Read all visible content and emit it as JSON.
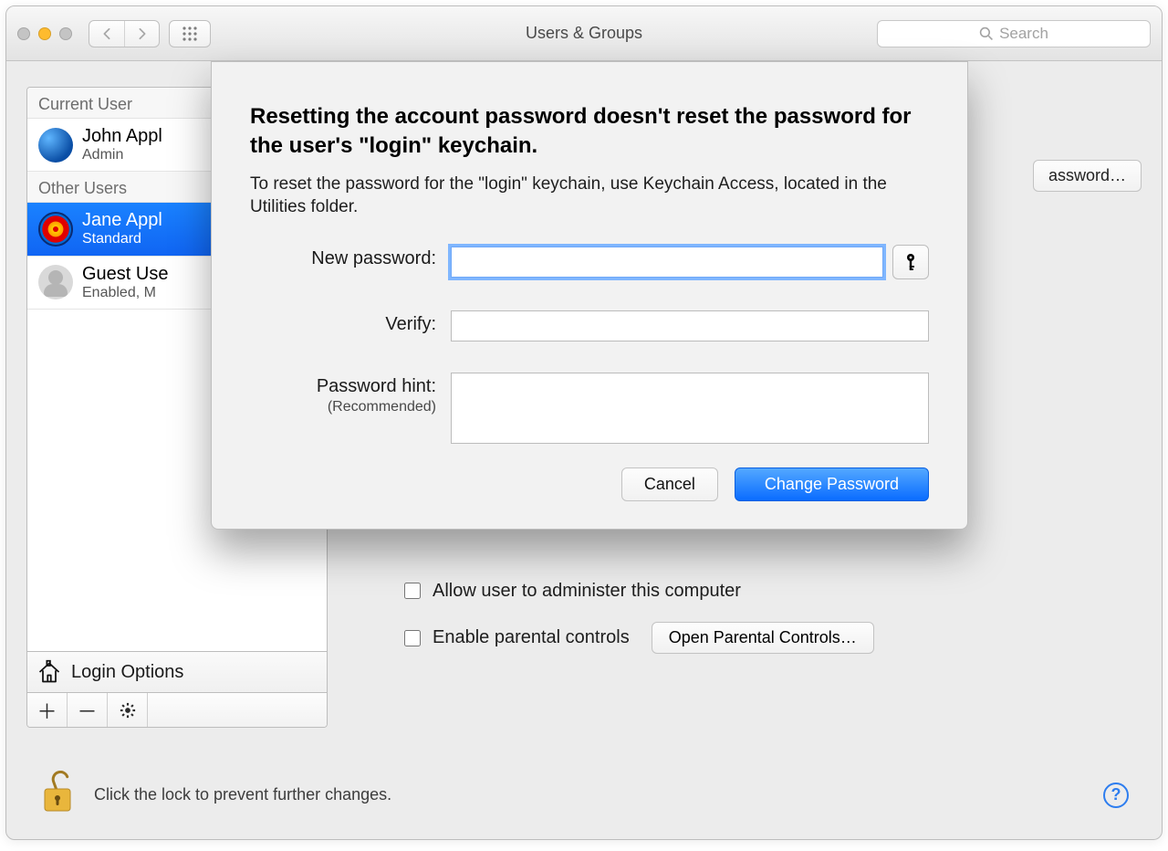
{
  "window": {
    "title": "Users & Groups",
    "search_placeholder": "Search"
  },
  "sidebar": {
    "current_label": "Current User",
    "other_label": "Other Users",
    "current_user": {
      "name": "John Appl",
      "role": "Admin"
    },
    "other_users": [
      {
        "name": "Jane Appl",
        "role": "Standard",
        "selected": true
      },
      {
        "name": "Guest Use",
        "role": "Enabled, M",
        "selected": false
      }
    ],
    "login_options": "Login Options"
  },
  "main": {
    "reset_button": "assword…",
    "admin_check": "Allow user to administer this computer",
    "parental_check": "Enable parental controls",
    "open_parental": "Open Parental Controls…"
  },
  "lock": {
    "text": "Click the lock to prevent further changes."
  },
  "sheet": {
    "heading": "Resetting the account password doesn't reset the password for the user's \"login\" keychain.",
    "sub": "To reset the password for the \"login\" keychain, use Keychain Access, located in the Utilities folder.",
    "new_password_label": "New password:",
    "verify_label": "Verify:",
    "hint_label": "Password hint:",
    "hint_recommended": "(Recommended)",
    "cancel": "Cancel",
    "change": "Change Password"
  }
}
